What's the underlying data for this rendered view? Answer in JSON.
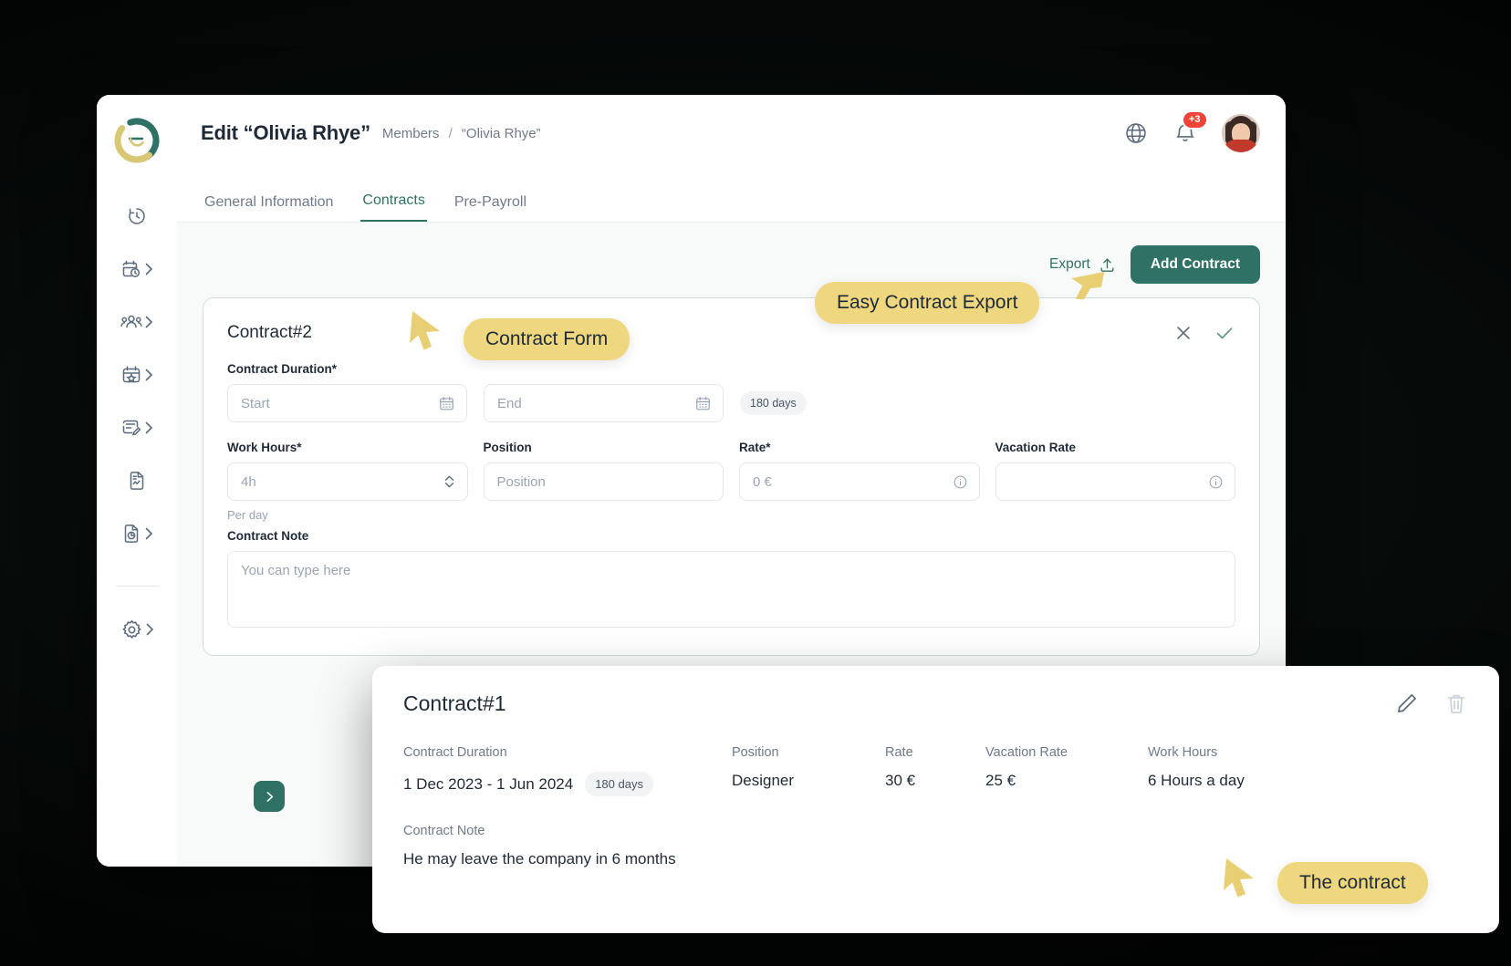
{
  "header": {
    "page_title": "Edit “Olivia Rhye”",
    "breadcrumb_parent": "Members",
    "breadcrumb_sep": "/",
    "breadcrumb_current": "“Olivia Rhye”",
    "language_icon": "globe-icon",
    "notifications_icon": "bell-icon",
    "notifications_badge": "+3",
    "avatar": "user-avatar"
  },
  "sidebar": {
    "logo": "company-logo",
    "items": [
      {
        "name": "time-tracking",
        "icon": "timer-icon",
        "has_chevron": false
      },
      {
        "name": "schedule",
        "icon": "calendar-clock-icon",
        "has_chevron": true
      },
      {
        "name": "members",
        "icon": "people-icon",
        "has_chevron": true
      },
      {
        "name": "events",
        "icon": "calendar-star-icon",
        "has_chevron": true
      },
      {
        "name": "requests",
        "icon": "note-edit-icon",
        "has_chevron": true
      },
      {
        "name": "documents",
        "icon": "file-chart-icon",
        "has_chevron": false
      },
      {
        "name": "reports",
        "icon": "file-pie-icon",
        "has_chevron": true
      },
      {
        "name": "settings",
        "icon": "gear-icon",
        "has_chevron": true
      }
    ],
    "expand_icon": "chevron-right-icon"
  },
  "tabs": [
    {
      "label": "General Information",
      "active": false
    },
    {
      "label": "Contracts",
      "active": true
    },
    {
      "label": "Pre-Payroll",
      "active": false
    }
  ],
  "actions": {
    "export_label": "Export",
    "export_icon": "upload-icon",
    "add_contract_label": "Add Contract"
  },
  "contract_form": {
    "title": "Contract#2",
    "cancel_icon": "close-icon",
    "confirm_icon": "check-icon",
    "duration_label": "Contract Duration*",
    "start_placeholder": "Start",
    "end_placeholder": "End",
    "calendar_icon": "calendar-icon",
    "duration_pill": "180 days",
    "work_hours_label": "Work Hours*",
    "work_hours_value": "4h",
    "stepper_icon": "up-down-chevron-icon",
    "work_hours_helper": "Per day",
    "position_label": "Position",
    "position_placeholder": "Position",
    "rate_label": "Rate*",
    "rate_placeholder": "0 €",
    "rate_info_icon": "info-icon",
    "vacation_rate_label": "Vacation Rate",
    "vacation_rate_placeholder": "",
    "vacation_info_icon": "info-icon",
    "note_label": "Contract Note",
    "note_placeholder": "You can type here"
  },
  "contract_detail": {
    "title": "Contract#1",
    "edit_icon": "pencil-icon",
    "delete_icon": "trash-icon",
    "columns": [
      {
        "label": "Contract Duration",
        "value": "1 Dec 2023 - 1 Jun 2024",
        "pill": "180 days"
      },
      {
        "label": "Position",
        "value": "Designer",
        "pill": ""
      },
      {
        "label": "Rate",
        "value": "30 €",
        "pill": ""
      },
      {
        "label": "Vacation Rate",
        "value": "25 €",
        "pill": ""
      },
      {
        "label": "Work Hours",
        "value": "6 Hours a day",
        "pill": ""
      }
    ],
    "note_label": "Contract Note",
    "note_value": "He may leave the company in 6 months"
  },
  "callouts": [
    {
      "text": "Contract Form"
    },
    {
      "text": "Easy Contract Export"
    },
    {
      "text": "The contract"
    }
  ],
  "colors": {
    "brand_green": "#2f7265",
    "callout_yellow": "#eed77f",
    "badge_red": "#f04438",
    "cursor_yellow": "#e8cf73"
  }
}
